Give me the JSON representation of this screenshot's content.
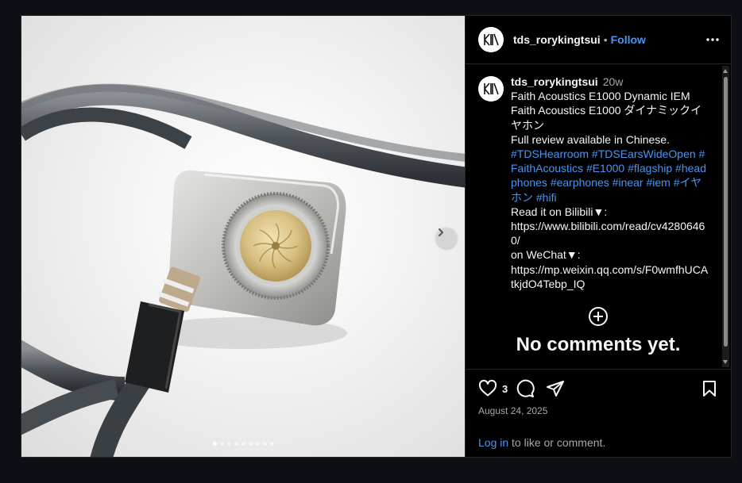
{
  "post": {
    "username": "tds_rorykingtsui",
    "separator": "•",
    "follow_label": "Follow",
    "avatar_logo_text": "KING TSUI"
  },
  "caption": {
    "time": "20w",
    "lines": [
      "Faith Acoustics E1000 Dynamic IEM",
      "Faith Acoustics E1000 ダイナミックイヤホン",
      "Full review available in Chinese."
    ],
    "hashtags": [
      "#TDSHearroom",
      "#TDSEarsWideOpen",
      "#FaithAcoustics",
      "#E1000",
      "#flagship",
      "#headphones",
      "#earphones",
      "#inear",
      "#iem",
      "#イヤホン",
      "#hifi"
    ],
    "lines2": [
      "Read it on Bilibili▼:",
      "https://www.bilibili.com/read/cv42806460/",
      "on WeChat▼:",
      "https://mp.weixin.qq.com/s/F0wmfhUCAtkjdO4Tebp_IQ"
    ]
  },
  "comments": {
    "empty_title": "No comments yet."
  },
  "actions": {
    "like_count": "3",
    "date": "August 24, 2025",
    "login_link": "Log in",
    "login_rest": " to like or comment."
  },
  "carousel": {
    "total": 9,
    "active": 0
  },
  "colors": {
    "link": "#4a95f0",
    "background": "#0c1014",
    "panel": "#000000"
  }
}
